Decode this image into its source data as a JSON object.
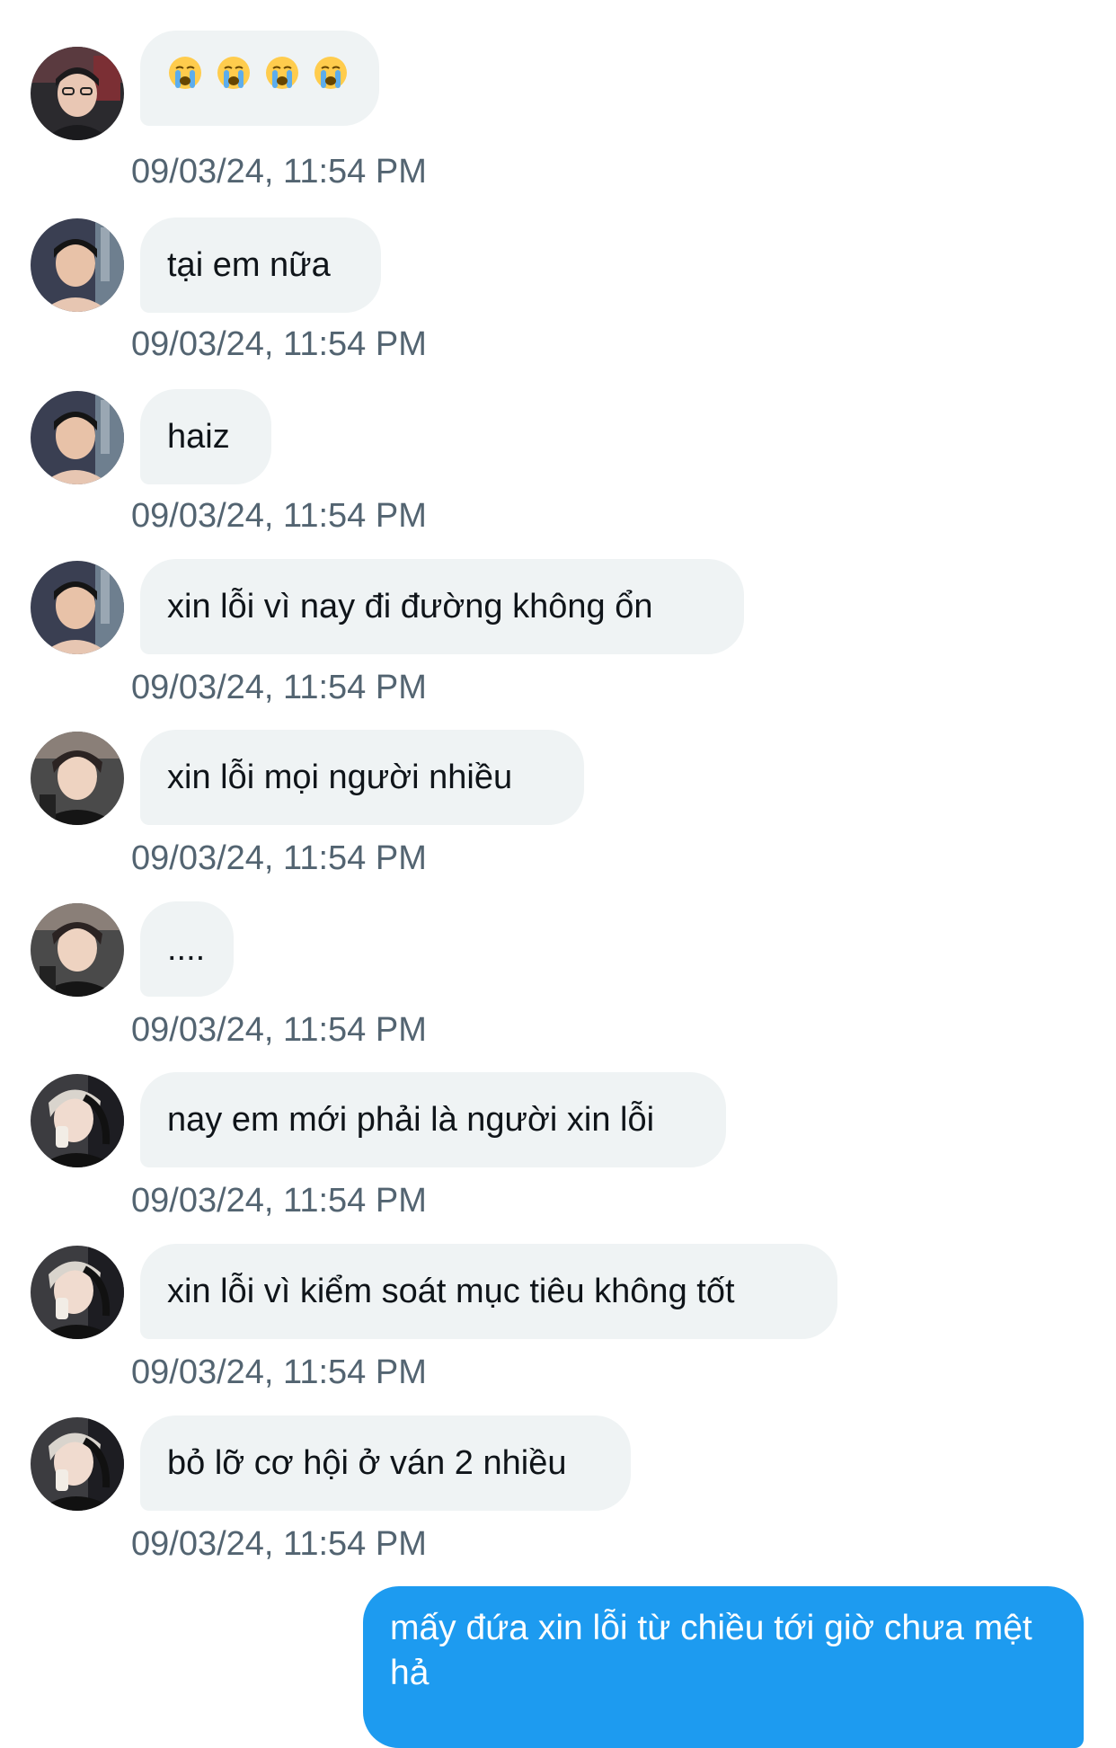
{
  "messages": [
    {
      "text": "",
      "emoji": [
        "crying-face",
        "crying-face",
        "crying-face",
        "crying-face"
      ],
      "timestamp": "09/03/24, 11:54 PM",
      "avatar": "avatar-1"
    },
    {
      "text": "tại em nữa",
      "timestamp": "09/03/24, 11:54 PM",
      "avatar": "avatar-2"
    },
    {
      "text": "haiz",
      "timestamp": "09/03/24, 11:54 PM",
      "avatar": "avatar-2"
    },
    {
      "text": "xin lỗi vì nay đi đường không ổn",
      "timestamp": "09/03/24, 11:54 PM",
      "avatar": "avatar-2"
    },
    {
      "text": "xin lỗi mọi người nhiều",
      "timestamp": "09/03/24, 11:54 PM",
      "avatar": "avatar-3"
    },
    {
      "text": "....",
      "timestamp": "09/03/24, 11:54 PM",
      "avatar": "avatar-3"
    },
    {
      "text": "nay em mới phải là người xin lỗi",
      "timestamp": "09/03/24, 11:54 PM",
      "avatar": "avatar-4"
    },
    {
      "text": "xin lỗi vì kiểm soát mục tiêu không tốt",
      "timestamp": "09/03/24, 11:54 PM",
      "avatar": "avatar-4"
    },
    {
      "text": "bỏ lỡ cơ hội ở ván 2 nhiều",
      "timestamp": "09/03/24, 11:54 PM",
      "avatar": "avatar-4"
    }
  ],
  "self_message": {
    "text": "mấy đứa xin lỗi từ chiều tới giờ chưa mệt hả"
  },
  "colors": {
    "incoming_bubble": "#eff3f4",
    "outgoing_bubble": "#1d9bf0",
    "timestamp": "#536471",
    "text": "#0f1419"
  }
}
